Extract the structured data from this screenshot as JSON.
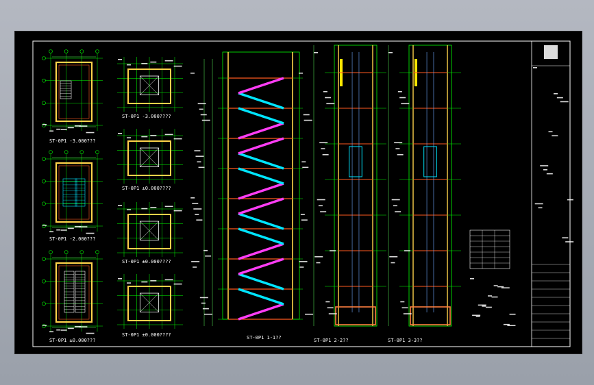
{
  "colors": {
    "background": "#a3a8b2",
    "paper": "#000000",
    "frame": "#ffffff",
    "grid": "#00ff00",
    "wall": "#ffd24a",
    "stair": "#00e5ff",
    "flight": "#ff3df5",
    "dim": "#5cff5c",
    "text": "#ffffff"
  },
  "plans": [
    {
      "label": "ST-0P1 -3.000???"
    },
    {
      "label": "ST-0P1 -2.000???"
    },
    {
      "label": "ST-0P1 ±0.000???"
    }
  ],
  "elevator_plans": [
    {
      "label": "ST-0P1 -3.000????"
    },
    {
      "label": "ST-0P1 ±0.000????"
    },
    {
      "label": "ST-0P1 ±0.000????"
    },
    {
      "label": "ST-0P1 ±0.000????"
    }
  ],
  "stair_section": {
    "label": "ST-0P1  1-1??"
  },
  "shaft_sections": [
    {
      "label": "ST-0P1  2-2??"
    },
    {
      "label": "ST-0P1  3-3??"
    }
  ]
}
